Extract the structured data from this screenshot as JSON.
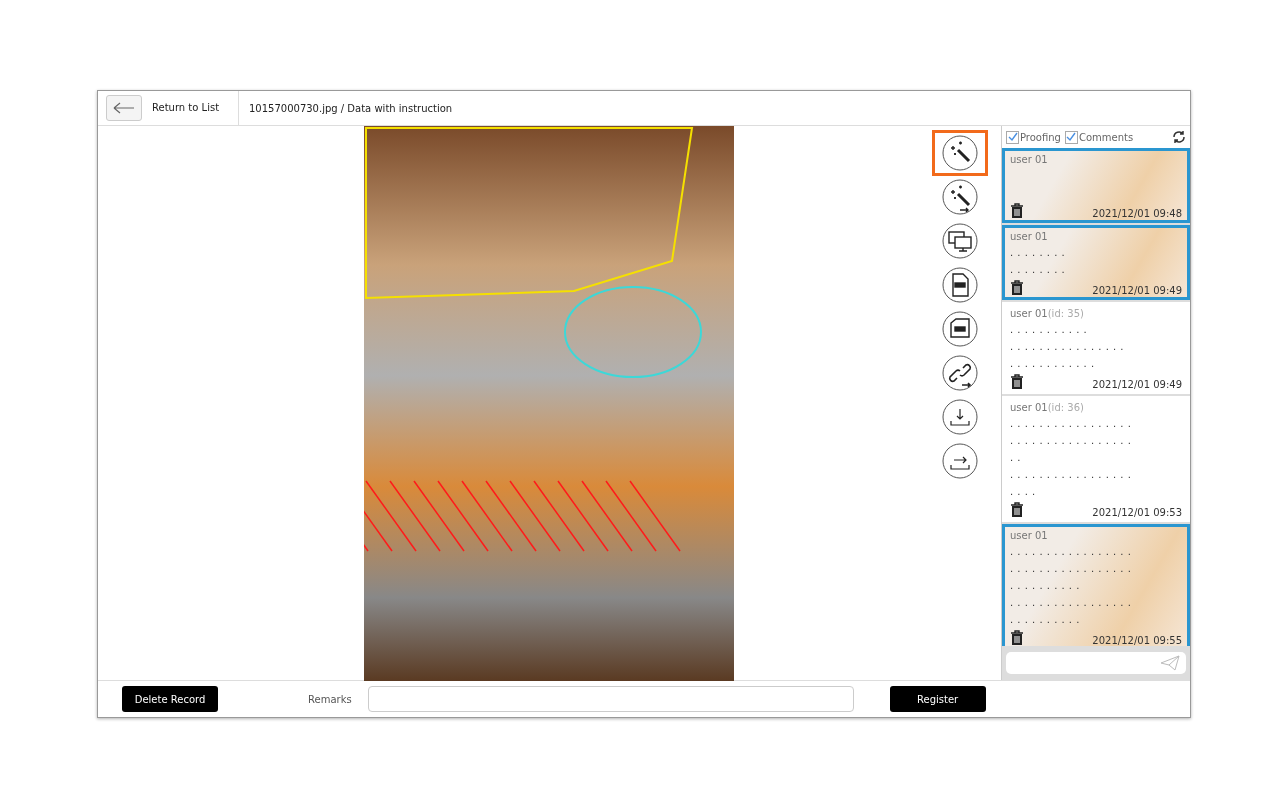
{
  "header": {
    "back_label": "Return to List",
    "file_title": "10157000730.jpg / Data with instruction"
  },
  "tools": [
    {
      "kind": "wand",
      "selected": true
    },
    {
      "kind": "wand-arrow",
      "selected": false
    },
    {
      "kind": "monitors",
      "selected": false
    },
    {
      "kind": "pdf",
      "selected": false
    },
    {
      "kind": "pdf-back",
      "selected": false
    },
    {
      "kind": "link",
      "selected": false
    },
    {
      "kind": "download",
      "selected": false
    },
    {
      "kind": "export",
      "selected": false
    }
  ],
  "filters": [
    {
      "label": "Proofing",
      "checked": true
    },
    {
      "label": "Comments",
      "checked": true
    }
  ],
  "comments": [
    {
      "user": "user 01",
      "selected": true,
      "time": "2021/12/01 09:48"
    },
    {
      "user": "user 01",
      "selected": true,
      "lines": [
        ". . . . . . . .",
        ". . . . . . . ."
      ],
      "time": "2021/12/01 09:49"
    },
    {
      "user": "user 01",
      "id": "(id: 35)",
      "selected": false,
      "lines": [
        ". . . . . . . . . . .",
        ". . . . . . . . . . . . . . . .",
        ". . . . . . . . . . . ."
      ],
      "time": "2021/12/01 09:49"
    },
    {
      "user": "user 01",
      "id": "(id: 36)",
      "selected": false,
      "lines": [
        ". . . . . . . . . . . . . . . . .",
        ". . . . . . . . . . . . . . . . .",
        ". .",
        ". . . . . . . . . . . . . . . . .",
        ". . . ."
      ],
      "time": "2021/12/01 09:53"
    },
    {
      "user": "user 01",
      "selected": true,
      "lines": [
        ". . . . . . . . . . . . . . . . .",
        ". . . . . . . . . . . . . . . . .",
        ". . . . . . . . . .",
        ". . . . . . . . . . . . . . . . .",
        ". . . . . . . . . ."
      ],
      "time": "2021/12/01 09:55"
    }
  ],
  "footer": {
    "delete_label": "Delete Record",
    "remarks_label": "Remarks",
    "register_label": "Register"
  }
}
